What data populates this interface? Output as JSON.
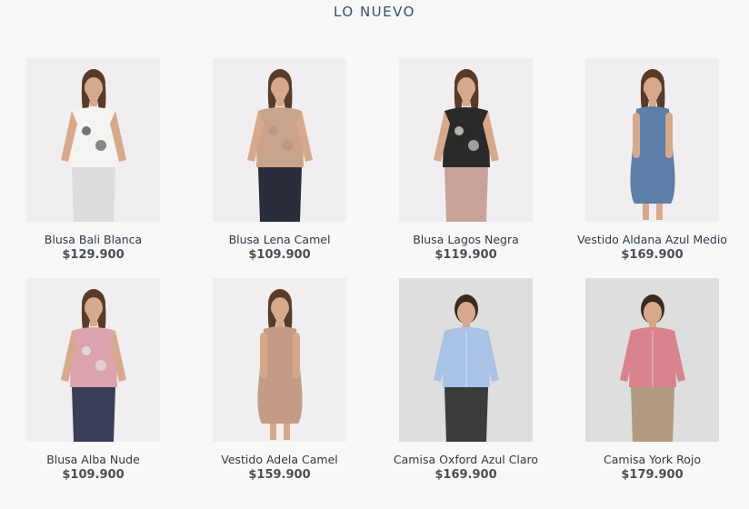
{
  "section": {
    "title": "LO NUEVO"
  },
  "products": [
    {
      "name": "Blusa Bali Blanca",
      "price": "$129.900",
      "icon": "product-photo-white-print-blouse",
      "colors": {
        "top": "#f4f4f2",
        "bottom": "#dcdcdc",
        "accent": "#3b3b3b"
      }
    },
    {
      "name": "Blusa Lena Camel",
      "price": "$109.900",
      "icon": "product-photo-camel-blouse",
      "colors": {
        "top": "#c9a48b",
        "bottom": "#2a2e3a",
        "accent": "#b8907a"
      }
    },
    {
      "name": "Blusa Lagos Negra",
      "price": "$119.900",
      "icon": "product-photo-black-print-blouse",
      "colors": {
        "top": "#2a2a2a",
        "bottom": "#c9a39a",
        "accent": "#f2efe9"
      }
    },
    {
      "name": "Vestido Aldana Azul Medio",
      "price": "$169.900",
      "icon": "product-photo-blue-dress",
      "colors": {
        "top": "#5c7fa8",
        "bottom": "#5c7fa8",
        "accent": "#4a6a92"
      }
    },
    {
      "name": "Blusa Alba Nude",
      "price": "$109.900",
      "icon": "product-photo-pink-vest",
      "colors": {
        "top": "#dba3ad",
        "bottom": "#3a3f57",
        "accent": "#e9e9ee"
      }
    },
    {
      "name": "Vestido Adela Camel",
      "price": "$159.900",
      "icon": "product-photo-camel-dress",
      "colors": {
        "top": "#c49c86",
        "bottom": "#c49c86",
        "accent": "#a77f6a"
      }
    },
    {
      "name": "Camisa Oxford Azul Claro",
      "price": "$169.900",
      "icon": "product-photo-light-blue-shirt",
      "colors": {
        "top": "#a9c2e6",
        "bottom": "#3b3b3e",
        "accent": "#8fb0dc"
      }
    },
    {
      "name": "Camisa York Rojo",
      "price": "$179.900",
      "icon": "product-photo-pink-shirt",
      "colors": {
        "top": "#d9838f",
        "bottom": "#b29a7e",
        "accent": "#c66f7c"
      }
    }
  ]
}
